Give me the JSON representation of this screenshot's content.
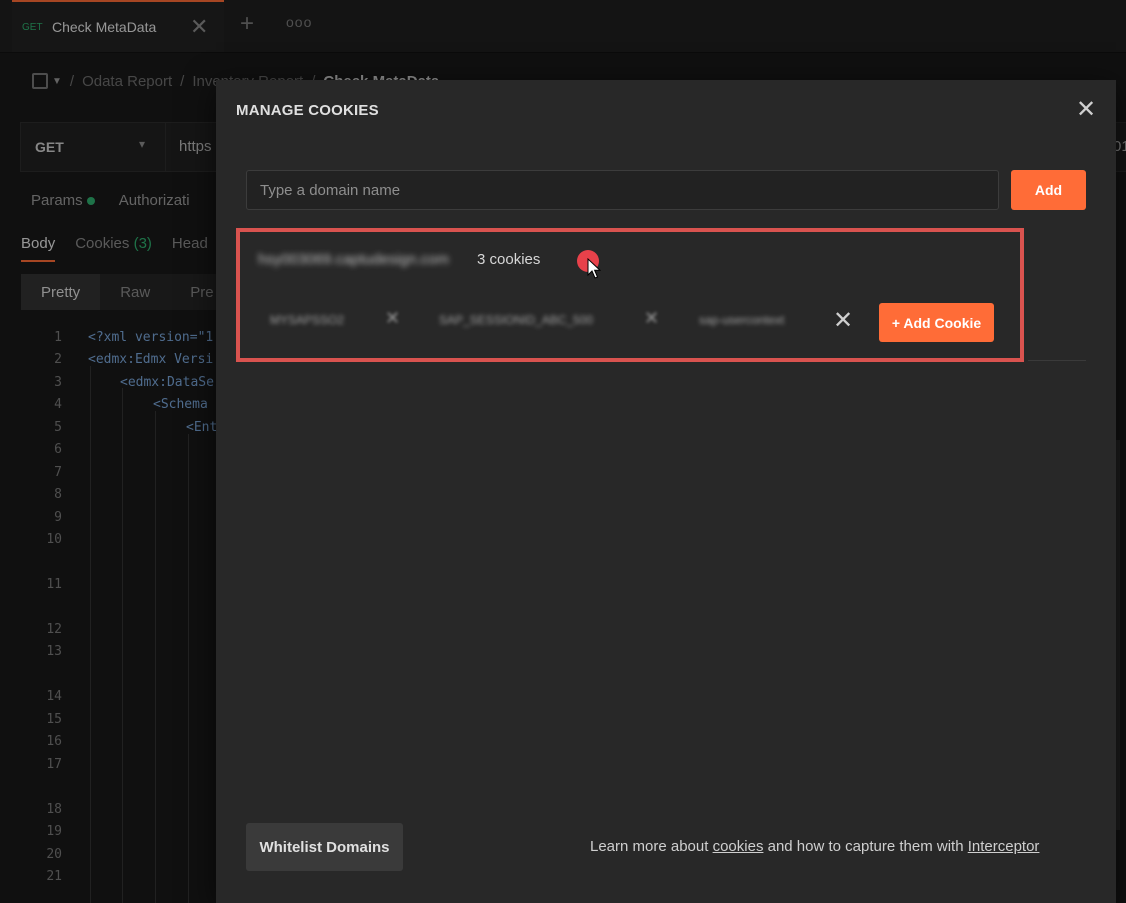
{
  "tab": {
    "method": "GET",
    "title": "Check MetaData",
    "close_icon": "close-icon",
    "new_tab_symbol": "+",
    "more_symbol": "ooo"
  },
  "breadcrumb": {
    "items": [
      "Odata Report",
      "Inventory Report",
      "Check MetaData"
    ]
  },
  "request": {
    "method": "GET",
    "url": "https",
    "url_tail": "01"
  },
  "request_tabs": {
    "params": "Params",
    "authorization": "Authorizati"
  },
  "response_tabs": {
    "body": "Body",
    "cookies": "Cookies",
    "cookies_count": "(3)",
    "headers": "Head"
  },
  "view_tabs": {
    "pretty": "Pretty",
    "raw": "Raw",
    "preview": "Pre"
  },
  "code": {
    "line_numbers": [
      "1",
      "2",
      "3",
      "4",
      "5",
      "6",
      "7",
      "8",
      "9",
      "10",
      "11",
      "12",
      "13",
      "14",
      "15",
      "16",
      "17",
      "18",
      "19",
      "20",
      "21"
    ],
    "lines": [
      "<?xml version=\"1",
      "<edmx:Edmx Versi",
      "<edmx:DataSe",
      "<Schema",
      "<Ent"
    ]
  },
  "modal": {
    "title": "MANAGE COOKIES",
    "domain_placeholder": "Type a domain name",
    "domain_value": "",
    "add_label": "Add",
    "domain_name": "hsy003069.captudesign.com",
    "cookie_count": "3 cookies",
    "cookies": [
      "SAP_SESSIONID_ABC_500",
      "sap-usercontext",
      "MYSAPSSO2"
    ],
    "add_cookie_label": "+ Add Cookie",
    "whitelist_label": "Whitelist Domains",
    "footer": {
      "prefix": "Learn more about ",
      "cookies_link": "cookies",
      "middle": " and how to capture them with ",
      "interceptor_link": "Interceptor"
    }
  },
  "colors": {
    "accent": "#ff6c37",
    "highlight": "#d9534f",
    "success": "#2fb06f",
    "record_dot": "#e8414a"
  }
}
